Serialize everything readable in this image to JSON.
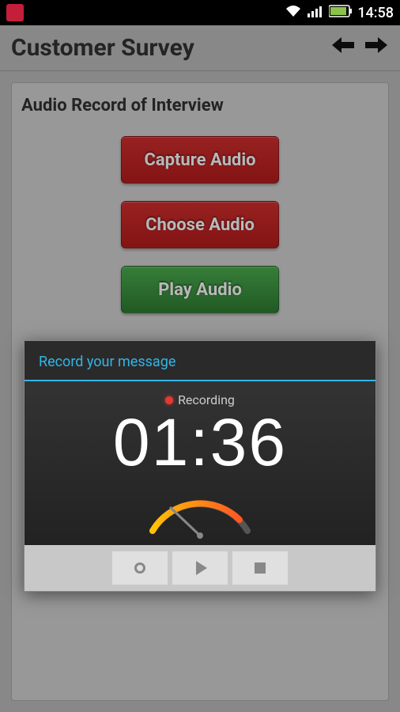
{
  "status": {
    "time": "14:58"
  },
  "titlebar": {
    "title": "Customer Survey"
  },
  "card": {
    "heading": "Audio Record of Interview",
    "buttons": {
      "capture": "Capture Audio",
      "choose": "Choose Audio",
      "play": "Play Audio"
    }
  },
  "dialog": {
    "header": "Record your message",
    "status": "Recording",
    "timer": "01:36"
  }
}
